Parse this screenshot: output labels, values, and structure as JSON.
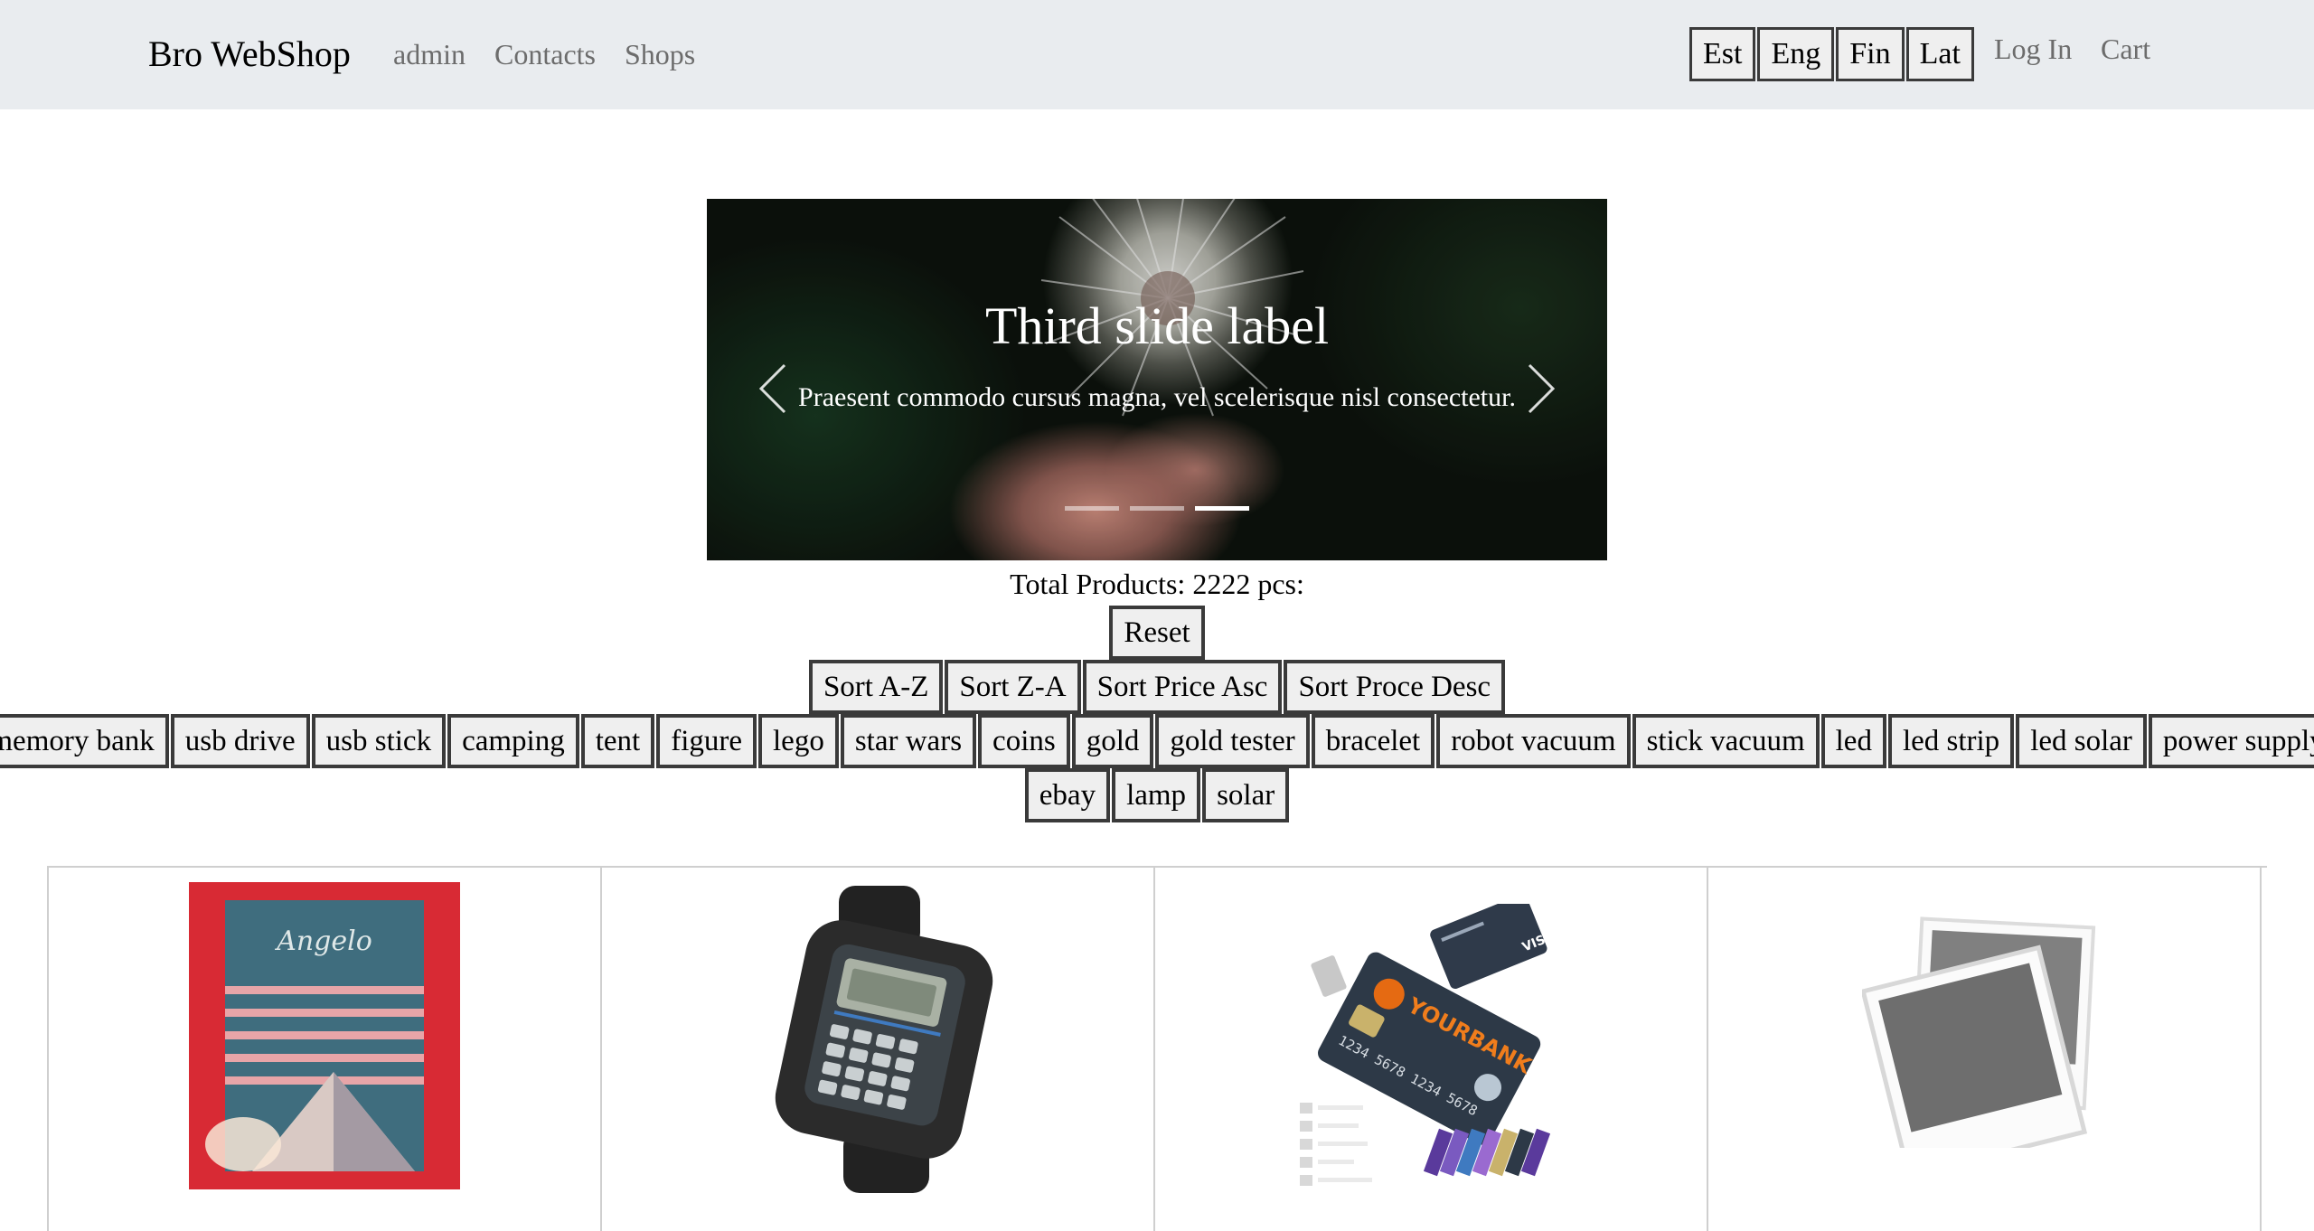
{
  "navbar": {
    "brand": "Bro WebShop",
    "links": [
      "admin",
      "Contacts",
      "Shops"
    ],
    "languages": [
      "Est",
      "Eng",
      "Fin",
      "Lat"
    ],
    "login": "Log In",
    "cart": "Cart"
  },
  "carousel": {
    "title": "Third slide label",
    "text": "Praesent commodo cursus magna, vel scelerisque nisl consectetur.",
    "slide_count": 3,
    "active_index": 2
  },
  "summary": {
    "total_text": "Total Products: 2222 pcs:"
  },
  "buttons": {
    "reset": "Reset",
    "sort": [
      "Sort A-Z",
      "Sort Z-A",
      "Sort Price Asc",
      "Sort Proce Desc"
    ]
  },
  "categories": {
    "row1": [
      "memory bank",
      "usb drive",
      "usb stick",
      "camping",
      "tent",
      "figure",
      "lego",
      "star wars",
      "coins",
      "gold",
      "gold tester",
      "bracelet",
      "robot vacuum",
      "stick vacuum",
      "led",
      "led strip",
      "led solar",
      "power supply"
    ],
    "row2": [
      "ebay",
      "lamp",
      "solar"
    ]
  },
  "products": [
    {
      "image": "book-cover-image"
    },
    {
      "image": "calculator-watch-image"
    },
    {
      "image": "credit-card-usb-image"
    },
    {
      "image": "placeholder-photo-image"
    }
  ],
  "colors": {
    "navbar_bg": "#e9ecef",
    "button_bg": "#efefef",
    "button_border": "#3a3a3a",
    "nav_link": "#6c6c6c"
  }
}
